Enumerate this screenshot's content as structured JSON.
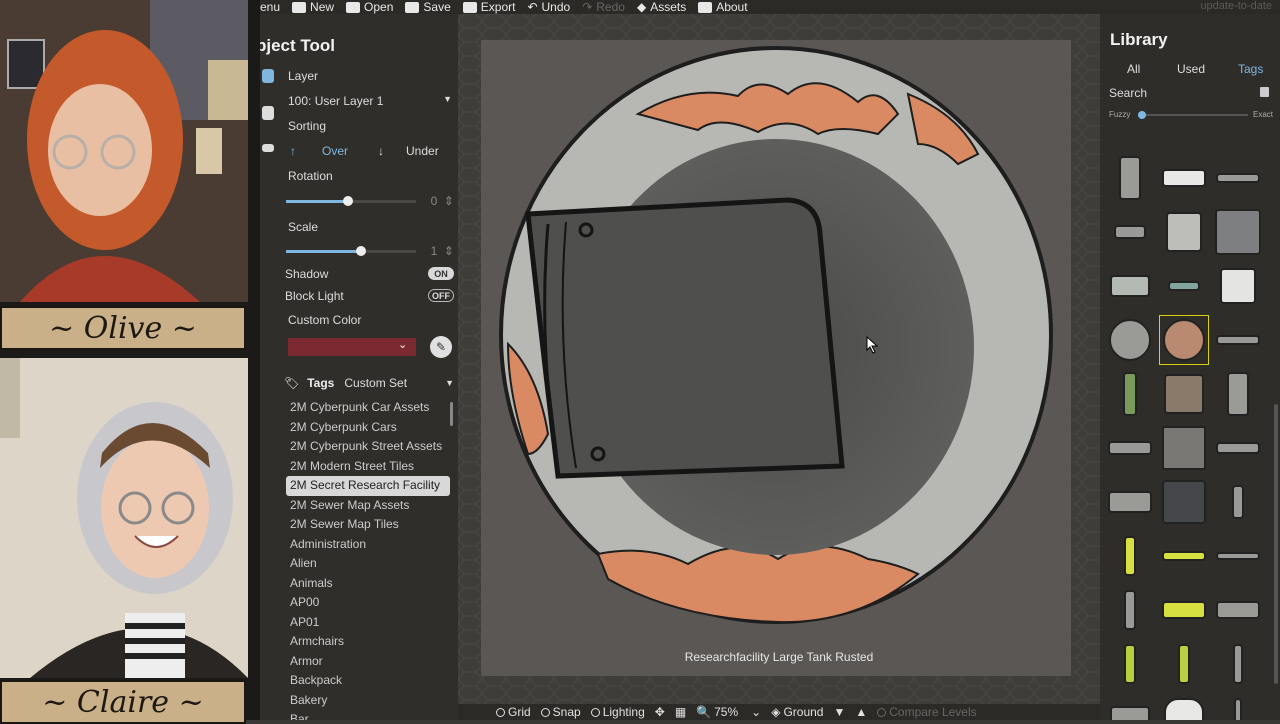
{
  "streamers": [
    {
      "name": "~ Olive ~"
    },
    {
      "name": "~ Claire ~"
    }
  ],
  "toolbar": {
    "items": [
      {
        "label": "enu",
        "icon": "menu-icon",
        "enabled": true
      },
      {
        "label": "New",
        "icon": "new-icon",
        "enabled": true
      },
      {
        "label": "Open",
        "icon": "open-icon",
        "enabled": true
      },
      {
        "label": "Save",
        "icon": "save-icon",
        "enabled": true
      },
      {
        "label": "Export",
        "icon": "export-icon",
        "enabled": true
      },
      {
        "label": "Undo",
        "icon": "undo-icon",
        "enabled": true
      },
      {
        "label": "Redo",
        "icon": "redo-icon",
        "enabled": false
      },
      {
        "label": "Assets",
        "icon": "assets-icon",
        "enabled": true
      },
      {
        "label": "About",
        "icon": "about-icon",
        "enabled": true
      }
    ],
    "status": "update-to-date"
  },
  "object_tool": {
    "title": "bject Tool",
    "layer_label": "Layer",
    "layer_value": "100: User Layer 1",
    "sorting_label": "Sorting",
    "sort_over": "Over",
    "sort_under": "Under",
    "rotation_label": "Rotation",
    "rotation_value": "0",
    "rotation_fraction": 0.48,
    "scale_label": "Scale",
    "scale_value": "1",
    "scale_fraction": 0.58,
    "shadow_label": "Shadow",
    "shadow_state": "ON",
    "block_light_label": "Block Light",
    "block_light_state": "OFF",
    "custom_color_label": "Custom Color",
    "custom_color": "#7c2a32",
    "tags_label": "Tags",
    "tags_set": "Custom Set",
    "tag_list": [
      "2M Cyberpunk Car Assets",
      "2M Cyberpunk Cars",
      "2M Cyberpunk Street Assets",
      "2M Modern Street Tiles",
      "2M Secret Research Facility",
      "2M Sewer Map Assets",
      "2M Sewer Map Tiles",
      "Administration",
      "Alien",
      "Animals",
      "AP00",
      "AP01",
      "Armchairs",
      "Armor",
      "Backpack",
      "Bakery",
      "Bar"
    ],
    "selected_tag": "2M Secret Research Facility"
  },
  "canvas": {
    "asset_name": "Researchfacility Large Tank Rusted"
  },
  "bottom_bar": {
    "grid": "Grid",
    "snap": "Snap",
    "lighting": "Lighting",
    "zoom": "75%",
    "level": "Ground",
    "compare": "Compare Levels"
  },
  "library": {
    "title": "Library",
    "tab_all": "All",
    "tab_used": "Used",
    "tab_tags": "Tags",
    "search_label": "Search",
    "fuzzy_label": "Fuzzy",
    "exact_label": "Exact"
  },
  "colors": {
    "accent": "#7fb7e0",
    "rust": "#d98a63",
    "tank_rim": "#b9b9b5",
    "nameplate": "#c9b089"
  }
}
